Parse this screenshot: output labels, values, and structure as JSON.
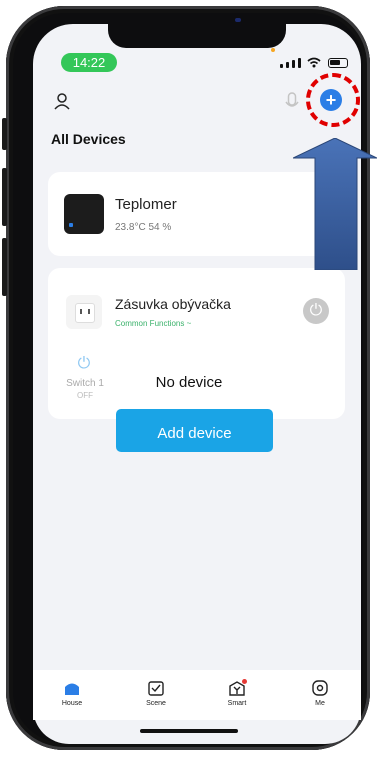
{
  "status_bar": {
    "time": "14:22"
  },
  "header": {
    "title": "All Devices"
  },
  "devices": [
    {
      "name": "Teplomer",
      "meta": "23.8°C  54 %"
    },
    {
      "name": "Zásuvka obývačka",
      "sub": "Common Functions ~",
      "switch_label": "Switch 1",
      "switch_state": "OFF"
    }
  ],
  "empty_state": {
    "message": "No device",
    "add_button": "Add device"
  },
  "tabs": [
    {
      "label": "House"
    },
    {
      "label": "Scene"
    },
    {
      "label": "Smart"
    },
    {
      "label": "Me"
    }
  ],
  "colors": {
    "accent": "#2b7ee6",
    "add_button": "#1aa4e6",
    "annotation_ring": "#e00000",
    "annotation_arrow": "#3a63a8"
  }
}
